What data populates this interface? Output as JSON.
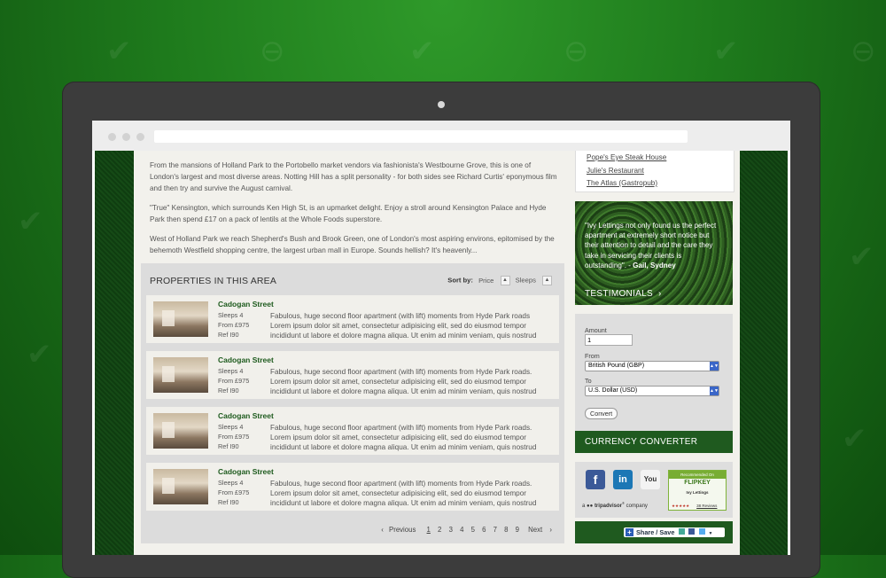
{
  "intro": {
    "p1": "From the mansions of Holland Park to the Portobello market vendors via fashionista's Westbourne Grove, this is one of London's largest and most diverse areas. Notting Hill has a split personality - for both sides see Richard Curtis' eponymous film and then try and survive the August carnival.",
    "p2": "\"True\" Kensington, which surrounds Ken High St, is an upmarket delight. Enjoy a stroll around Kensington Palace and Hyde Park then spend £17 on a pack of lentils at the Whole Foods superstore.",
    "p3": "West of Holland Park we reach Shepherd's Bush and Brook Green, one of London's most aspiring environs, epitomised by the behemoth Westfield shopping centre, the largest urban mall in Europe. Sounds hellish? It's heavenly..."
  },
  "properties": {
    "title": "PROPERTIES IN THIS AREA",
    "sort_label": "Sort by:",
    "sort_price": "Price",
    "sort_sleeps": "Sleeps",
    "items": [
      {
        "name": "Cadogan Street",
        "sleeps": "Sleeps 4",
        "from": "From £975",
        "ref": "Ref I90",
        "desc": "Fabulous, huge second floor apartment (with lift) moments from Hyde Park roads Lorem ipsum dolor sit amet, consectetur adipisicing elit, sed do eiusmod tempor incididunt ut labore et dolore magna aliqua. Ut enim ad minim veniam, quis nostrud"
      },
      {
        "name": "Cadogan Street",
        "sleeps": "Sleeps 4",
        "from": "From £975",
        "ref": "Ref I90",
        "desc": "Fabulous, huge second floor apartment (with lift) moments from Hyde Park roads. Lorem ipsum dolor sit amet, consectetur adipisicing elit, sed do eiusmod tempor incididunt ut labore et dolore magna aliqua. Ut enim ad minim veniam, quis nostrud"
      },
      {
        "name": "Cadogan Street",
        "sleeps": "Sleeps 4",
        "from": "From £975",
        "ref": "Ref I90",
        "desc": "Fabulous, huge second floor apartment (with lift) moments from Hyde Park roads. Lorem ipsum dolor sit amet, consectetur adipisicing elit, sed do eiusmod tempor incididunt ut labore et dolore magna aliqua. Ut enim ad minim veniam, quis nostrud"
      },
      {
        "name": "Cadogan Street",
        "sleeps": "Sleeps 4",
        "from": "From £975",
        "ref": "Ref I90",
        "desc": "Fabulous, huge second floor apartment (with lift) moments from Hyde Park roads. Lorem ipsum dolor sit amet, consectetur adipisicing elit, sed do eiusmod tempor incididunt ut labore et dolore magna aliqua. Ut enim ad minim veniam, quis nostrud"
      }
    ]
  },
  "pager": {
    "prev": "Previous",
    "pages": [
      "1",
      "2",
      "3",
      "4",
      "5",
      "6",
      "7",
      "8",
      "9"
    ],
    "current": "1",
    "next": "Next"
  },
  "restaurants": [
    "Pope's Eye Steak House",
    "Julie's Restaurant",
    "The Atlas (Gastropub)"
  ],
  "testimonial": {
    "quote": "\"Ivy Lettings not only found us the perfect apartment at extremely short notice but their attention to detail and the care they take in servicing their clients is outstanding\". - ",
    "author": "Gail, Sydney",
    "label": "TESTIMONIALS",
    "arrow": "›"
  },
  "converter": {
    "amount_label": "Amount",
    "amount_value": "1",
    "from_label": "From",
    "from_value": "British Pound (GBP)",
    "to_label": "To",
    "to_value": "U.S. Dollar (USD)",
    "button": "Convert",
    "title": "CURRENCY CONVERTER"
  },
  "social": {
    "facebook": "f",
    "linkedin": "in",
    "youtube": "You",
    "flip_top": "Recommended On",
    "flip_logo": "FLIPKEY",
    "flip_name": "Ivy Lettings",
    "flip_stars": "★★★★★",
    "flip_reviews": "38 Reviews",
    "trip_a": "a",
    "trip_brand": "tripadvisor",
    "trip_company": "company"
  },
  "share": {
    "label": "Share / Save"
  },
  "colors": {
    "brand_green": "#1f5a1f",
    "link_green": "#1d5a1d",
    "background_green": "#1e7a1c"
  }
}
